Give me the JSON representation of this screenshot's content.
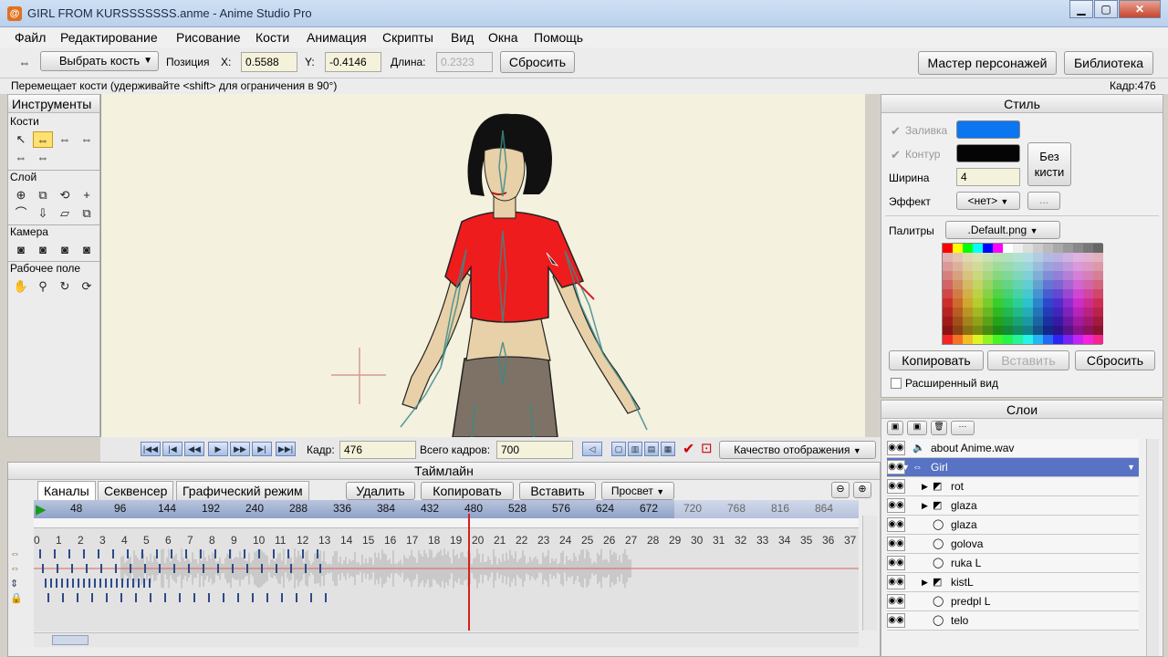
{
  "window": {
    "title": "GIRL FROM KURSSSSSSS.anme - Anime Studio Pro",
    "minimize": "▁",
    "maximize": "▢",
    "close": "✕"
  },
  "menu": [
    "Файл",
    "Редактирование",
    "Рисование",
    "Кости",
    "Анимация",
    "Скрипты",
    "Вид",
    "Окна",
    "Помощь"
  ],
  "toolbar": {
    "tool_select": "Выбрать кость",
    "position_label": "Позиция",
    "x_label": "X:",
    "x_value": "0.5588",
    "y_label": "Y:",
    "y_value": "-0.4146",
    "length_label": "Длина:",
    "length_value": "0.2323",
    "reset_button": "Сбросить",
    "character_wizard": "Мастер персонажей",
    "library": "Библиотека"
  },
  "status": {
    "hint": "Перемещает кости (удерживайте <shift> для ограничения в 90°)",
    "frame": "Кадр:476"
  },
  "tools": {
    "title": "Инструменты",
    "sections": {
      "bones": "Кости",
      "layer": "Слой",
      "camera": "Камера",
      "workspace": "Рабочее поле"
    }
  },
  "style": {
    "title": "Стиль",
    "fill_label": "Заливка",
    "fill_color": "#0b76f0",
    "stroke_label": "Контур",
    "stroke_color": "#050505",
    "no_brush": "Без кисти",
    "width_label": "Ширина",
    "width_value": "4",
    "effect_label": "Эффект",
    "effect_value": "<нет>",
    "effect_more": "...",
    "palette_label": "Палитры",
    "palette_value": ".Default.png",
    "copy_button": "Копировать",
    "paste_button": "Вставить",
    "reset_button": "Сбросить",
    "advanced_view": "Расширенный вид"
  },
  "playback": {
    "frame_label": "Кадр:",
    "frame_value": "476",
    "total_label": "Всего кадров:",
    "total_value": "700",
    "quality": "Качество отображения"
  },
  "timeline": {
    "title": "Таймлайн",
    "tabs": [
      "Каналы",
      "Секвенсер",
      "Графический режим"
    ],
    "delete": "Удалить",
    "copy": "Копировать",
    "paste": "Вставить",
    "onion": "Просвет",
    "ruler": [
      "48",
      "96",
      "144",
      "192",
      "240",
      "288",
      "336",
      "384",
      "432",
      "480",
      "528",
      "576",
      "624",
      "672",
      "720",
      "768",
      "816",
      "864"
    ],
    "frames": [
      "0",
      "1",
      "2",
      "3",
      "4",
      "5",
      "6",
      "7",
      "8",
      "9",
      "10",
      "11",
      "12",
      "13",
      "14",
      "15",
      "16",
      "17",
      "18",
      "19",
      "20",
      "21",
      "22",
      "23",
      "24",
      "25",
      "26",
      "27",
      "28",
      "29",
      "30",
      "31",
      "32",
      "33",
      "34",
      "35",
      "36",
      "37"
    ]
  },
  "layers": {
    "title": "Слои",
    "rows": [
      {
        "name": "about Anime.wav",
        "icon": "sound-icon",
        "indent": 0
      },
      {
        "name": "Girl",
        "icon": "bone-group-icon",
        "indent": 0,
        "selected": true
      },
      {
        "name": "rot",
        "icon": "image-icon",
        "indent": 1
      },
      {
        "name": "glaza",
        "icon": "image-icon",
        "indent": 1
      },
      {
        "name": "glaza",
        "icon": "vector-icon",
        "indent": 1
      },
      {
        "name": "golova",
        "icon": "vector-icon",
        "indent": 1
      },
      {
        "name": "ruka L",
        "icon": "vector-icon",
        "indent": 1
      },
      {
        "name": "kistL",
        "icon": "image-icon",
        "indent": 1
      },
      {
        "name": "predpl L",
        "icon": "vector-icon",
        "indent": 1
      },
      {
        "name": "telo",
        "icon": "vector-icon",
        "indent": 1
      }
    ]
  }
}
